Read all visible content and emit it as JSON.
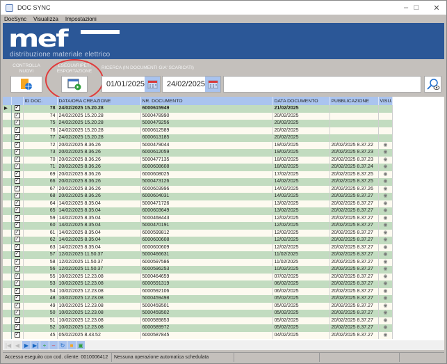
{
  "window": {
    "title": "DOC SYNC"
  },
  "menu": [
    "DocSync",
    "Visualizza",
    "Impostazioni"
  ],
  "banner": {
    "logo": "mef",
    "tagline": "distribuzione materiale elettrico"
  },
  "toolbar": {
    "check_new_label": "CONTROLLA NUOVI",
    "export_label": "ESEGUI/RIPETI ESPORTAZIONE",
    "search_label": "RICERCA (IN DOCUMENTI GIA' SCARICATI)",
    "date_from": "01/01/2025",
    "date_to": "24/02/2025",
    "search_value": ""
  },
  "grid": {
    "columns": [
      "",
      "",
      "ID DOC.",
      "DATA/ORA CREAZIONE",
      "NR. DOCUMENTO",
      "DATA DOCUMENTO",
      "PUBBLICAZIONE",
      "VISU."
    ],
    "rows": [
      [
        "78",
        "24/02/2025 15.20.28",
        "6000615949",
        "21/02/2025",
        ""
      ],
      [
        "74",
        "24/02/2025 15.20.28",
        "5000478990",
        "20/02/2025",
        ""
      ],
      [
        "75",
        "24/02/2025 15.20.28",
        "5000479256",
        "20/02/2025",
        ""
      ],
      [
        "76",
        "24/02/2025 15.20.28",
        "6000612589",
        "20/02/2025",
        ""
      ],
      [
        "77",
        "24/02/2025 15.20.28",
        "6000613185",
        "20/02/2025",
        ""
      ],
      [
        "72",
        "20/02/2025 8.36.26",
        "5000479044",
        "19/02/2025",
        "20/02/2025 8.37.22"
      ],
      [
        "73",
        "20/02/2025 8.36.26",
        "6000612059",
        "19/02/2025",
        "20/02/2025 8.37.23"
      ],
      [
        "70",
        "20/02/2025 8.36.26",
        "5000477135",
        "18/02/2025",
        "20/02/2025 8.37.23"
      ],
      [
        "71",
        "20/02/2025 8.36.26",
        "6000608608",
        "18/02/2025",
        "20/02/2025 8.37.24"
      ],
      [
        "69",
        "20/02/2025 8.36.26",
        "6000608025",
        "17/02/2025",
        "20/02/2025 8.37.25"
      ],
      [
        "66",
        "20/02/2025 8.36.26",
        "5000473126",
        "14/02/2025",
        "20/02/2025 8.37.25"
      ],
      [
        "67",
        "20/02/2025 8.36.26",
        "6000603996",
        "14/02/2025",
        "20/02/2025 8.37.26"
      ],
      [
        "68",
        "20/02/2025 8.36.26",
        "6000604031",
        "14/02/2025",
        "20/02/2025 8.37.27"
      ],
      [
        "64",
        "14/02/2025 8.35.04",
        "5000471726",
        "13/02/2025",
        "20/02/2025 8.37.27"
      ],
      [
        "65",
        "14/02/2025 8.35.04",
        "6000603649",
        "13/02/2025",
        "20/02/2025 8.37.27"
      ],
      [
        "59",
        "14/02/2025 8.35.04",
        "5000468443",
        "12/02/2025",
        "20/02/2025 8.37.27"
      ],
      [
        "60",
        "14/02/2025 8.35.04",
        "5000470191",
        "12/02/2025",
        "20/02/2025 8.37.27"
      ],
      [
        "61",
        "14/02/2025 8.35.04",
        "6000599812",
        "12/02/2025",
        "20/02/2025 8.37.27"
      ],
      [
        "62",
        "14/02/2025 8.35.04",
        "6000600608",
        "12/02/2025",
        "20/02/2025 8.37.27"
      ],
      [
        "63",
        "14/02/2025 8.35.04",
        "6000600609",
        "12/02/2025",
        "20/02/2025 8.37.27"
      ],
      [
        "57",
        "12/02/2025 11.50.37",
        "5000466631",
        "11/02/2025",
        "20/02/2025 8.37.27"
      ],
      [
        "58",
        "12/02/2025 11.50.37",
        "6000597586",
        "11/02/2025",
        "20/02/2025 8.37.27"
      ],
      [
        "56",
        "12/02/2025 11.50.37",
        "6000596253",
        "10/02/2025",
        "20/02/2025 8.37.27"
      ],
      [
        "55",
        "10/02/2025 12.23.08",
        "5000464659",
        "07/02/2025",
        "20/02/2025 8.37.27"
      ],
      [
        "53",
        "10/02/2025 12.23.08",
        "6000591319",
        "06/02/2025",
        "20/02/2025 8.37.27"
      ],
      [
        "54",
        "10/02/2025 12.23.08",
        "6000592106",
        "06/02/2025",
        "20/02/2025 8.37.27"
      ],
      [
        "48",
        "10/02/2025 12.23.08",
        "5000459498",
        "05/02/2025",
        "20/02/2025 8.37.27"
      ],
      [
        "49",
        "10/02/2025 12.23.08",
        "5000459501",
        "05/02/2025",
        "20/02/2025 8.37.27"
      ],
      [
        "50",
        "10/02/2025 12.23.08",
        "5000459502",
        "05/02/2025",
        "20/02/2025 8.37.27"
      ],
      [
        "51",
        "10/02/2025 12.23.08",
        "6000589853",
        "05/02/2025",
        "20/02/2025 8.37.27"
      ],
      [
        "52",
        "10/02/2025 12.23.08",
        "6000589972",
        "05/02/2025",
        "20/02/2025 8.37.27"
      ],
      [
        "45",
        "05/02/2025 8.43.52",
        "6000587845",
        "04/02/2025",
        "20/02/2025 8.37.27"
      ]
    ]
  },
  "status": {
    "login": "Accesso eseguito con cod. cliente: 0010006412",
    "schedule": "Nessuna operazione automatica schedulata",
    "s3": "",
    "s4": ""
  },
  "colors": {
    "banner": "#2b5797",
    "row_even": "#c2dcc0",
    "row_odd": "#fdfaf0",
    "header": "#aac4ef",
    "highlight": "#e03c3c"
  }
}
